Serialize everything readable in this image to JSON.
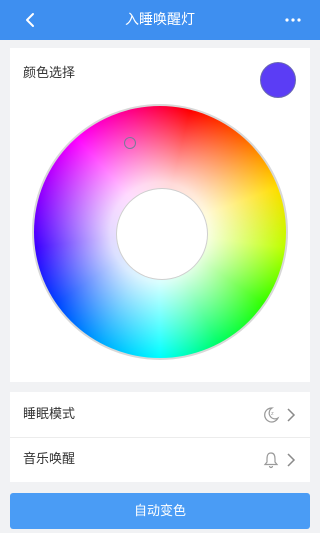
{
  "header": {
    "title": "入睡唤醒灯",
    "back_icon": "chevron-left-icon",
    "more_icon": "more-dots-icon",
    "color": "#3e8ff0"
  },
  "picker": {
    "label": "颜色选择",
    "selected_color": "#5b3df5",
    "thumb_hue_name": "blue-violet"
  },
  "settings": {
    "rows": [
      {
        "label": "睡眠模式",
        "icon": "sleep-moon-icon"
      },
      {
        "label": "音乐唤醒",
        "icon": "bell-icon"
      }
    ]
  },
  "auto_button": {
    "label": "自动变色",
    "color": "#4a9cf5"
  }
}
